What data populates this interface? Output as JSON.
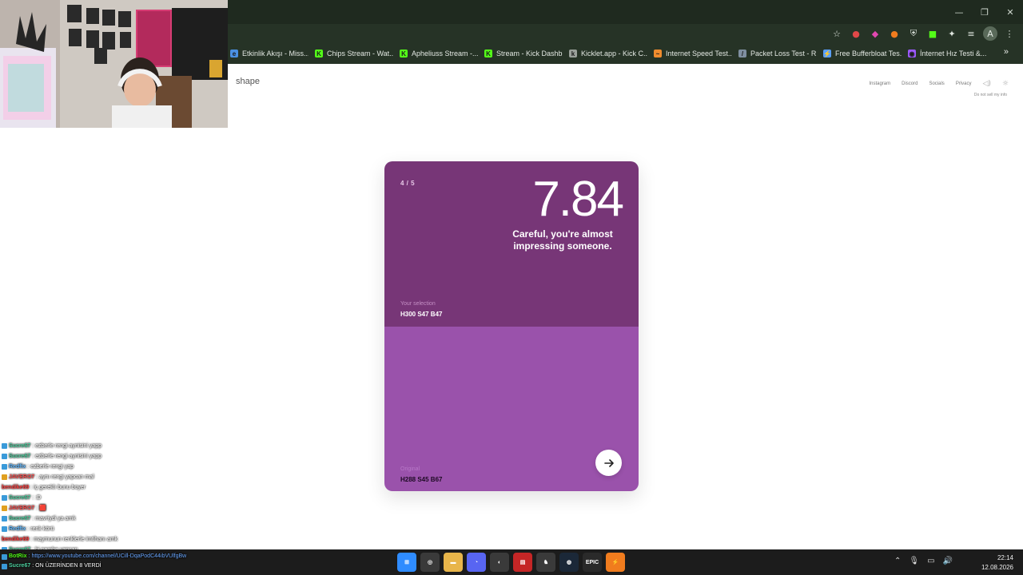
{
  "browser": {
    "bookmarks": [
      {
        "label": "Etkinlik Akışı - Miss...",
        "color": "#4a90e2",
        "glyph": "e"
      },
      {
        "label": "Chips Stream - Wat...",
        "color": "#53fc18",
        "glyph": "K"
      },
      {
        "label": "Apheliuss Stream -...",
        "color": "#53fc18",
        "glyph": "K"
      },
      {
        "label": "Stream - Kick Dashb...",
        "color": "#53fc18",
        "glyph": "K"
      },
      {
        "label": "Kicklet.app - Kick C...",
        "color": "#9aa09a",
        "glyph": "k"
      },
      {
        "label": "Internet Speed Test...",
        "color": "#f08c2e",
        "glyph": "~"
      },
      {
        "label": "Packet Loss Test - R...",
        "color": "#7f8fa0",
        "glyph": "/"
      },
      {
        "label": "Free Bufferbloat Tes...",
        "color": "#5aa0ff",
        "glyph": "⚡"
      },
      {
        "label": "İnternet Hız Testi &...",
        "color": "#9b59ff",
        "glyph": "◉"
      }
    ]
  },
  "site": {
    "logo": "shape",
    "nav": [
      "Instagram",
      "Discord",
      "Socials",
      "Privacy"
    ],
    "do_not_sell": "Do not sell my info"
  },
  "card": {
    "progress": "4 / 5",
    "score": "7.84",
    "message": "Careful, you're almost impressing someone.",
    "selection_label": "Your selection",
    "selection_value": "H300 S47 B47",
    "original_label": "Original",
    "original_value": "H288 S45 B67",
    "selection_color": "#773677",
    "original_color": "#9a52ab"
  },
  "chat": [
    {
      "user": "Sucre67",
      "msg": ": ezberle rengi aynisini yapp",
      "color": "#4fd1a0",
      "badge": "#3a9ad9"
    },
    {
      "user": "Sucre67",
      "msg": ": ezberle rengi aynisini yapp",
      "color": "#4fd1a0",
      "badge": "#3a9ad9"
    },
    {
      "user": "Redfix",
      "msg": ": ezberle rengi yap",
      "color": "#5fb8ff",
      "badge": "#3a9ad9"
    },
    {
      "user": "JAVERO7",
      "msg": ": aynı rengi yapcan mal",
      "color": "#ff4a4a",
      "badge": "#e0a020"
    },
    {
      "user": "bendike69",
      "msg": ": iç gereklı bunu boyer",
      "color": "#ff3b3b",
      "badge": ""
    },
    {
      "user": "Sucre67",
      "msg": ": :D",
      "color": "#4fd1a0",
      "badge": "#3a9ad9"
    },
    {
      "user": "JAVERO7",
      "msg": ": 🟥",
      "color": "#ff4a4a",
      "badge": "#e0a020"
    },
    {
      "user": "Sucre67",
      "msg": ": mavriydi ya amk",
      "color": "#4fd1a0",
      "badge": "#3a9ad9"
    },
    {
      "user": "Redfix",
      "msg": ": renk körü",
      "color": "#5fb8ff",
      "badge": "#3a9ad9"
    },
    {
      "user": "bendike69",
      "msg": ": maymunun renklerle imtihanı amk",
      "color": "#ff3b3b",
      "badge": ""
    },
    {
      "user": "Sucre67",
      "msg": ": bi pembe yapcan",
      "color": "#4fd1a0",
      "badge": "#3a9ad9"
    }
  ],
  "chat_bottom": [
    {
      "user": "BotRix",
      "msg": ": https://www.youtube.com/channel/UCill-DqaPodC44ibVUlfgBw",
      "color": "#53fc18",
      "msgcolor": "#6aa7ff",
      "badge": "#3a9ad9"
    },
    {
      "user": "Sucre67",
      "msg": ": ON ÜZERİNDEN 8 VERDİ",
      "color": "#4fd1a0",
      "msgcolor": "#ffffff",
      "badge": "#3a9ad9"
    }
  ],
  "taskbar": {
    "time": "22:14",
    "date": "12.08.2026",
    "apps": [
      {
        "name": "start-icon",
        "color": "#2f8cff",
        "glyph": "⊞"
      },
      {
        "name": "chrome-icon",
        "color": "#3a3a3a",
        "glyph": "◎"
      },
      {
        "name": "file-explorer-icon",
        "color": "#e8b54a",
        "glyph": "▬"
      },
      {
        "name": "discord-icon",
        "color": "#5865f2",
        "glyph": "◔"
      },
      {
        "name": "obs-icon",
        "color": "#3a3a3a",
        "glyph": "◐"
      },
      {
        "name": "app-red-icon",
        "color": "#c52626",
        "glyph": "▤"
      },
      {
        "name": "app-horse-icon",
        "color": "#3a3a3a",
        "glyph": "♞"
      },
      {
        "name": "steam-icon",
        "color": "#1b2838",
        "glyph": "◍"
      },
      {
        "name": "epic-games-icon",
        "color": "#2a2a2a",
        "glyph": "EPIC"
      },
      {
        "name": "app-orange-icon",
        "color": "#f07c1e",
        "glyph": "⚡"
      }
    ]
  }
}
